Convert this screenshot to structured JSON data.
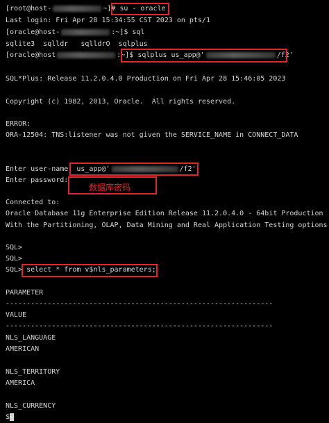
{
  "terminal": {
    "l1": {
      "prefix": "[root@host-",
      "suffix": "~]# ",
      "cmd": "su - oracle"
    },
    "l2": "Last login: Fri Apr 28 15:34:55 CST 2023 on pts/1",
    "l3": {
      "prefix": "[oracle@host-",
      "suffix": ":~]$ sql"
    },
    "l4": "sqlite3  sqlldr   sqlldrO  sqlplus",
    "l5": {
      "prefix": "[oracle@host",
      "suffix": ":~]$ ",
      "cmd_a": "sqlplus us_app@'",
      "cmd_b": "/f2'"
    },
    "l6": "SQL*Plus: Release 11.2.0.4.0 Production on Fri Apr 28 15:46:05 2023",
    "l7": "Copyright (c) 1982, 2013, Oracle.  All rights reserved.",
    "l8": "ERROR:",
    "l9": "ORA-12504: TNS:listener was not given the SERVICE_NAME in CONNECT_DATA",
    "l10": {
      "prompt": "Enter user-name: ",
      "val_a": "us_app@'",
      "val_b": "/f2'"
    },
    "l11": "Enter password: ",
    "password_annotation": "数据库密码",
    "l12": "Connected to:",
    "l13": "Oracle Database 11g Enterprise Edition Release 11.2.0.4.0 - 64bit Production",
    "l14": "With the Partitioning, OLAP, Data Mining and Real Application Testing options",
    "l15": "SQL>",
    "l16": "SQL>",
    "l17": {
      "prompt": "SQL> ",
      "cmd": "select * from v$nls_parameters;"
    },
    "l18": "PARAMETER",
    "l19": "----------------------------------------------------------------",
    "l20": "VALUE",
    "l21": "----------------------------------------------------------------",
    "l22": "NLS_LANGUAGE",
    "l23": "AMERICAN",
    "l24": "NLS_TERRITORY",
    "l25": "AMERICA",
    "l26": "NLS_CURRENCY",
    "l27": "$"
  },
  "colors": {
    "background": "#000000",
    "text": "#d6d6d6",
    "highlight": "#e0252b"
  }
}
